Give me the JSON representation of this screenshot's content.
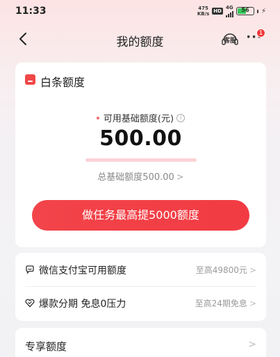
{
  "status_bar": {
    "time": "11:33",
    "net_speed_value": "475",
    "net_speed_unit": "KB/s",
    "hd": "HD",
    "network": "4G",
    "battery": "56",
    "battery_level": 0.56
  },
  "nav": {
    "title": "我的额度",
    "service_label": "客服",
    "more_label": "···",
    "notification_count": "1"
  },
  "card": {
    "title": "白条额度",
    "available_label": "可用基础额度(元)",
    "info_icon": "i",
    "amount": "500.00",
    "total_label": "总基础额度500.00",
    "chevron": ">",
    "task_button": "做任务最高提5000额度"
  },
  "list": {
    "items": [
      {
        "icon": "chat-bubble-icon",
        "label": "微信支付宝可用额度",
        "value": "至高49800元",
        "chevron": ">"
      },
      {
        "icon": "heart-shield-icon",
        "label": "爆款分期 免息0压力",
        "value": "至高24期免息",
        "chevron": ">"
      }
    ]
  },
  "exclusive": {
    "title": "专享额度",
    "chevron": ">"
  },
  "colors": {
    "accent": "#f2444a",
    "badge": "#f03a3a",
    "battery": "#35c759"
  }
}
